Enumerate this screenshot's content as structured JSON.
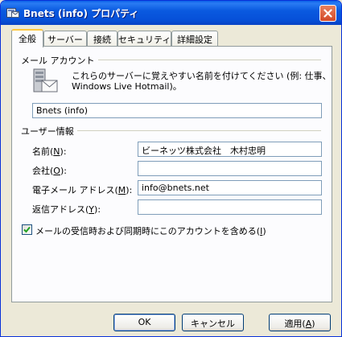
{
  "window": {
    "title": "Bnets (info) プロパティ"
  },
  "tabs": [
    {
      "label": "全般",
      "active": true
    },
    {
      "label": "サーバー",
      "active": false
    },
    {
      "label": "接続",
      "active": false
    },
    {
      "label": "セキュリティ",
      "active": false
    },
    {
      "label": "詳細設定",
      "active": false
    }
  ],
  "mail_account": {
    "group_label": "メール アカウント",
    "description_line1": "これらのサーバーに覚えやすい名前を付けてください (例: 仕事、",
    "description_line2": "Windows Live Hotmail)。",
    "account_name": "Bnets (info)"
  },
  "user_info": {
    "group_label": "ユーザー情報",
    "name_label": "名前(",
    "name_key": "N",
    "name_value": "ビーネッツ株式会社　木村忠明",
    "company_label": "会社(",
    "company_key": "O",
    "company_value": "",
    "email_label": "電子メール アドレス(",
    "email_key": "M",
    "email_value": "info@bnets.net",
    "reply_label": "返信アドレス(",
    "reply_key": "Y",
    "reply_value": "",
    "label_suffix": "):"
  },
  "include_account": {
    "checked": true,
    "label_before": "メールの受信時および同期時にこのアカウントを含める(",
    "label_key": "I",
    "label_after": ")"
  },
  "buttons": {
    "ok": "OK",
    "cancel": "キャンセル",
    "apply_before": "適用(",
    "apply_key": "A",
    "apply_after": ")"
  },
  "colors": {
    "titlebar": "#0a5ae0",
    "dialog_bg": "#ece9d8",
    "active_tab_accent": "#ffc83c",
    "field_border": "#7f9db9"
  }
}
